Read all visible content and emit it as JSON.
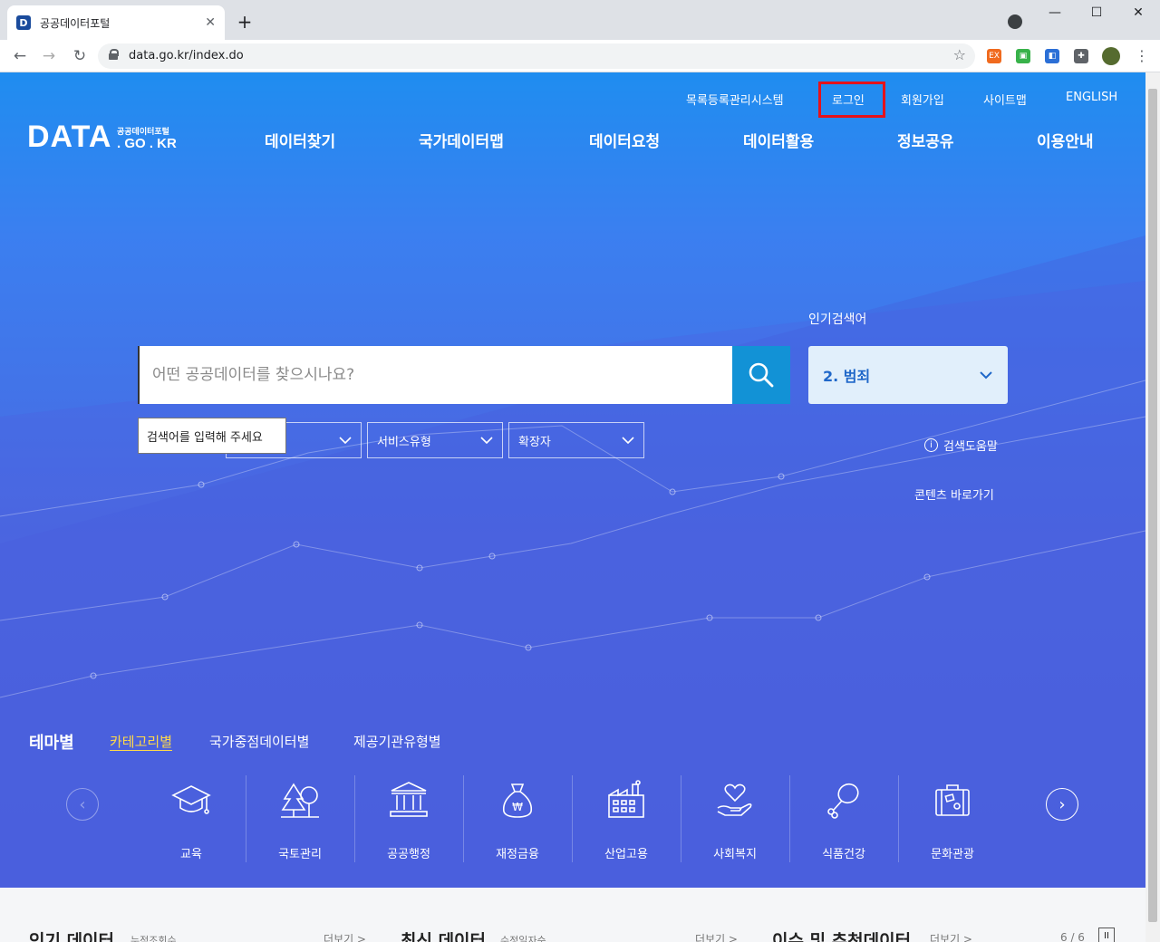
{
  "browser": {
    "tab_title": "공공데이터포털",
    "tab_close": "✕",
    "new_tab": "+",
    "url": "data.go.kr/index.do",
    "min": "—",
    "max": "☐",
    "close": "✕"
  },
  "util_nav": [
    "목록등록관리시스템",
    "로그인",
    "회원가입",
    "사이트맵",
    "ENGLISH"
  ],
  "logo": {
    "main": "DATA",
    "sub": "공공데이터포털",
    "domain": ". GO . KR"
  },
  "gnb": [
    "데이터찾기",
    "국가데이터맵",
    "데이터요청",
    "데이터활용",
    "정보공유",
    "이용안내"
  ],
  "search": {
    "placeholder": "어떤 공공데이터를 찾으시나요?",
    "popular_label": "인기검색어",
    "popular_current": "2. 범죄",
    "tooltip": "검색어를 입력해 주세요",
    "filters": [
      "서비스유형",
      "확장자"
    ],
    "help": "검색도움말",
    "contents": "콘텐츠 바로가기"
  },
  "theme_tabs": {
    "title": "테마별",
    "items": [
      "카테고리별",
      "국가중점데이터별",
      "제공기관유형별"
    ]
  },
  "categories": [
    "교육",
    "국토관리",
    "공공행정",
    "재정금융",
    "산업고용",
    "사회복지",
    "식품건강",
    "문화관광"
  ],
  "bottom": {
    "popular_title": "인기 데이터",
    "popular_sub": "누적조회수",
    "more": "더보기 >",
    "latest_title": "최신 데이터",
    "latest_sub": "수정일자순",
    "issue_title": "이슈 및 추천데이터",
    "pager": "6 / 6",
    "pause": "II"
  },
  "colors": {
    "accent_blue": "#1292d6",
    "login_highlight": "#e5121b",
    "active_tab": "#ffd94a"
  }
}
